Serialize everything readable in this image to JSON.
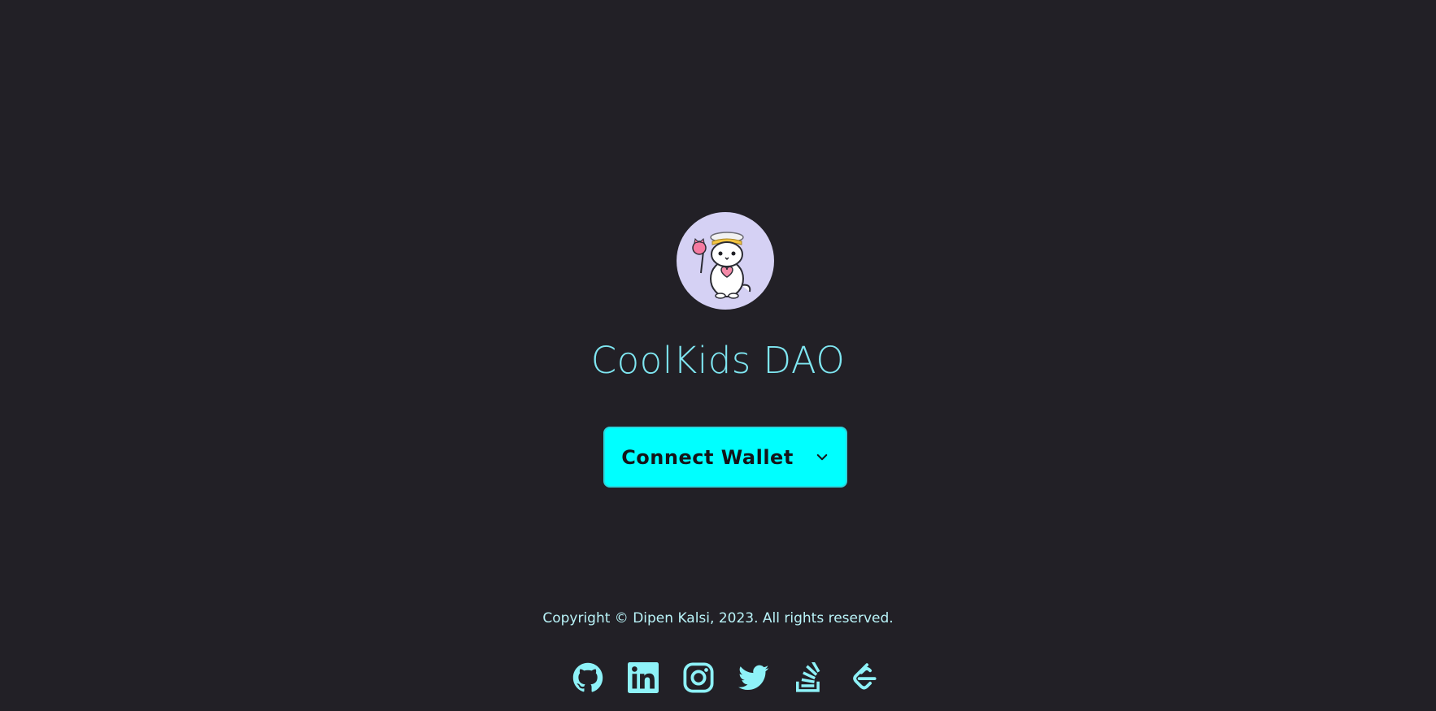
{
  "brand": {
    "title": "CoolKids DAO",
    "avatar_icon": "cartoon-cat-avatar"
  },
  "wallet": {
    "button_label": "Connect Wallet",
    "chevron_icon": "chevron-down-icon"
  },
  "footer": {
    "copyright": "Copyright © Dipen Kalsi, 2023. All rights reserved.",
    "socials": [
      {
        "name": "github-icon"
      },
      {
        "name": "linkedin-icon"
      },
      {
        "name": "instagram-icon"
      },
      {
        "name": "twitter-icon"
      },
      {
        "name": "stackoverflow-icon"
      },
      {
        "name": "leetcode-icon"
      }
    ]
  },
  "colors": {
    "background": "#222026",
    "accent": "#00ffff",
    "title_text": "#7fe7f2",
    "footer_text": "#b9f3f8",
    "icon": "#8ef2f8"
  }
}
